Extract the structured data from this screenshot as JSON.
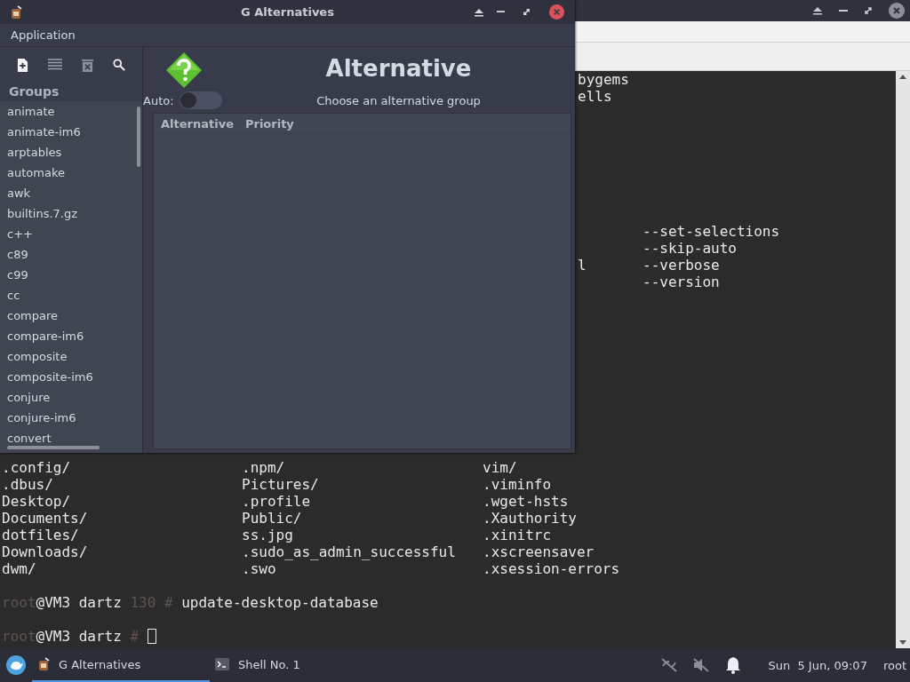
{
  "terminal_window": {
    "terminal": {
      "top_fragments": [
        "bygems",
        "ells"
      ],
      "option_lines": [
        {
          "option": "--set-selections"
        },
        {
          "option": "--skip-auto"
        },
        {
          "left": "l",
          "option": "--verbose"
        },
        {
          "option": "--version"
        }
      ],
      "listing": [
        [
          ".config/",
          ".npm/",
          "vim/"
        ],
        [
          ".dbus/",
          "Pictures/",
          ".viminfo"
        ],
        [
          "Desktop/",
          ".profile",
          ".wget-hsts"
        ],
        [
          "Documents/",
          "Public/",
          ".Xauthority"
        ],
        [
          "dotfiles/",
          "ss.jpg",
          ".xinitrc"
        ],
        [
          "Downloads/",
          ".sudo_as_admin_successful",
          ".xscreensaver"
        ],
        [
          "dwm/",
          ".swo",
          ".xsession-errors"
        ]
      ],
      "prompts": [
        {
          "user": "root",
          "host": "@VM3 dartz",
          "exit_code": "130",
          "symbol": "#",
          "command": "update-desktop-database",
          "cursor": false
        },
        {
          "user": "root",
          "host": "@VM3 dartz",
          "symbol": "#",
          "cursor": true
        }
      ]
    }
  },
  "alternatives_window": {
    "title": "G Alternatives",
    "menu": [
      "Application"
    ],
    "groups_heading": "Groups",
    "groups": [
      {
        "label": "animate",
        "selected": false
      },
      {
        "label": "animate-im6",
        "selected": false
      },
      {
        "label": "arptables",
        "selected": false
      },
      {
        "label": "automake",
        "selected": false
      },
      {
        "label": "awk",
        "selected": false
      },
      {
        "label": "builtins.7.gz",
        "selected": false
      },
      {
        "label": "c++",
        "selected": false
      },
      {
        "label": "c89",
        "selected": false
      },
      {
        "label": "c99",
        "selected": false
      },
      {
        "label": "cc",
        "selected": false
      },
      {
        "label": "compare",
        "selected": false
      },
      {
        "label": "compare-im6",
        "selected": false
      },
      {
        "label": "composite",
        "selected": false
      },
      {
        "label": "composite-im6",
        "selected": false
      },
      {
        "label": "conjure",
        "selected": false
      },
      {
        "label": "conjure-im6",
        "selected": false
      },
      {
        "label": "convert",
        "selected": false
      }
    ],
    "heading": "Alternative",
    "auto_label": "Auto:",
    "auto_on": false,
    "hint": "Choose an alternative group",
    "columns": [
      "Alternative",
      "Priority"
    ]
  },
  "taskbar": {
    "tasks": [
      {
        "label": "G Alternatives",
        "kind": "app",
        "selected": true
      },
      {
        "label": "Shell No. 1",
        "kind": "terminal",
        "selected": false
      }
    ],
    "clock": "Sun  5 Jun, 09:07",
    "user": "root"
  }
}
